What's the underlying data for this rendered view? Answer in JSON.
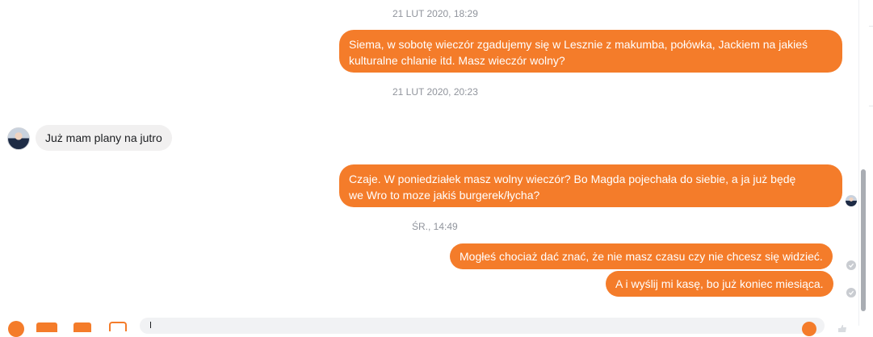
{
  "messages": [
    {
      "type": "timestamp",
      "text": "21 LUT 2020, 18:29"
    },
    {
      "type": "out",
      "lines": [
        "Siema, w sobotę wieczór zgadujemy się w Lesznie z makumba, połówka, Jackiem na jakieś",
        "kulturalne chlanie itd. Masz wieczór wolny?"
      ]
    },
    {
      "type": "timestamp",
      "text": "21 LUT 2020, 20:23"
    },
    {
      "type": "in",
      "text": "Już mam plany na jutro"
    },
    {
      "type": "out",
      "lines": [
        "Czaje. W poniedziałek masz wolny wieczór? Bo Magda pojechała do siebie, a ja już będę",
        "we Wro to moze jakiś burgerek/łycha?"
      ]
    },
    {
      "type": "timestamp",
      "text": "ŚR., 14:49"
    },
    {
      "type": "out",
      "text": "Mogłeś chociaż dać znać, że nie masz czasu czy nie chcesz się widzieć."
    },
    {
      "type": "out",
      "text": "A i wyślij mi kasę, bo już koniec miesiąca."
    }
  ],
  "colors": {
    "outgoing_bubble": "#f47c2a",
    "incoming_bubble": "#f1f0f0",
    "timestamp": "#90949c"
  },
  "icons": {
    "composer": [
      "more-actions-icon",
      "attachment-icon",
      "gif-icon",
      "sticker-icon",
      "emoji-icon",
      "like-icon"
    ],
    "status": "sent-check-icon"
  }
}
